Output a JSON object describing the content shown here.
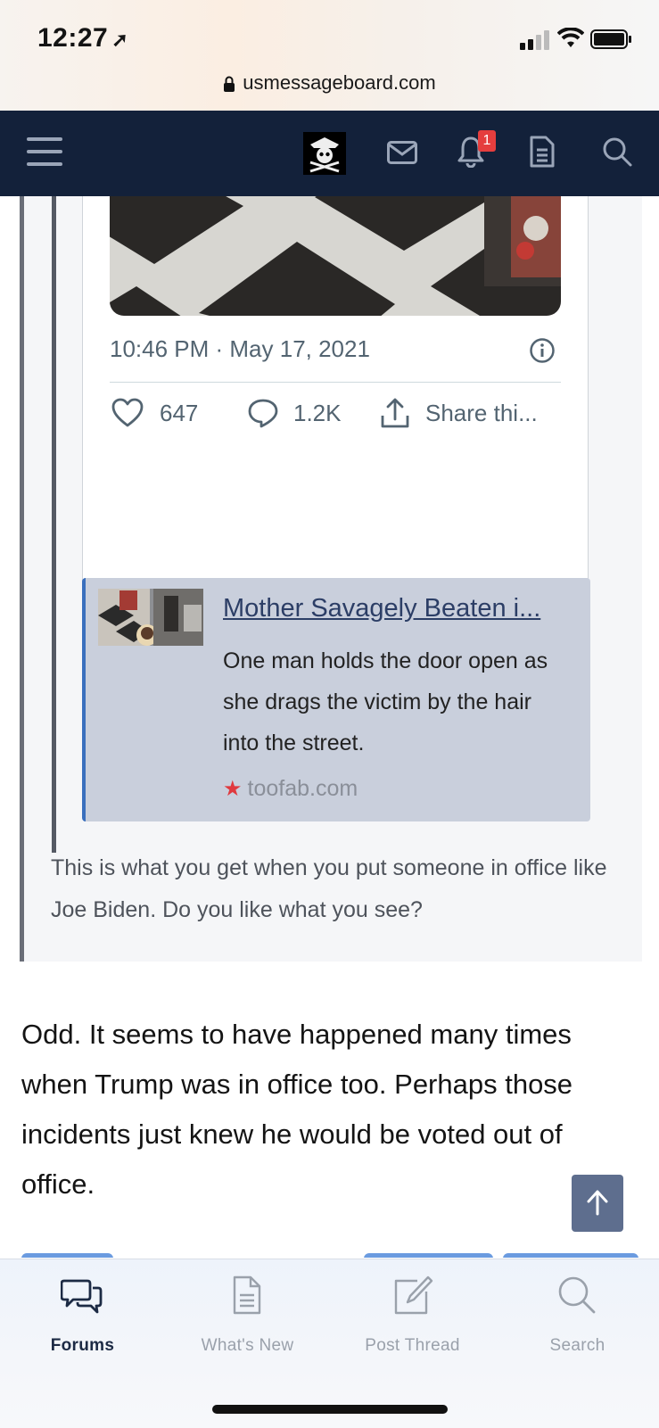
{
  "status_bar": {
    "time": "12:27",
    "url": "usmessageboard.com"
  },
  "nav": {
    "items": [
      {
        "name": "menu-icon"
      },
      {
        "name": "site-logo"
      },
      {
        "name": "inbox-icon"
      },
      {
        "name": "bell-icon"
      },
      {
        "name": "document-icon"
      },
      {
        "name": "search-icon"
      }
    ],
    "notification_count": "1",
    "background": "#13213a"
  },
  "tweet": {
    "timestamp": "10:46 PM · May 17, 2021",
    "likes": "647",
    "replies": "1.2K",
    "share_label": "Share thi..."
  },
  "link_preview": {
    "title": "Mother Savagely Beaten i...",
    "description": "One man holds the door open as she drags the victim by the hair into the street.",
    "site": "toofab.com"
  },
  "quote_text": "This is what you get when you put someone in office like Joe Biden. Do you like what you see?",
  "post_text": "Odd. It seems to have happened many times when Trump was in office too. Perhaps those incidents just knew he would be voted out of office.",
  "tabbar": {
    "tabs": [
      {
        "label": "Forums",
        "icon": "chat-bubbles-icon",
        "active": true
      },
      {
        "label": "What's New",
        "icon": "document-icon",
        "active": false
      },
      {
        "label": "Post Thread",
        "icon": "compose-icon",
        "active": false
      },
      {
        "label": "Search",
        "icon": "search-icon",
        "active": false
      }
    ]
  },
  "colors": {
    "accent": "#3a6fbd",
    "badge": "#e53e3e",
    "nav": "#13213a"
  }
}
